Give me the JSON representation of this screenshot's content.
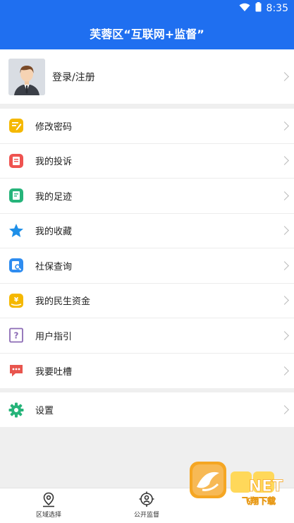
{
  "status_bar": {
    "time": "8:35"
  },
  "header": {
    "title": "芙蓉区“互联网+监督”"
  },
  "profile": {
    "label": "登录/注册"
  },
  "menu": [
    {
      "label": "修改密码",
      "icon": "edit-icon",
      "color": "#f5b800"
    },
    {
      "label": "我的投诉",
      "icon": "complaint-icon",
      "color": "#ef5350"
    },
    {
      "label": "我的足迹",
      "icon": "footprint-icon",
      "color": "#26b47a"
    },
    {
      "label": "我的收藏",
      "icon": "star-icon",
      "color": "#1e8fe8"
    },
    {
      "label": "社保查询",
      "icon": "search-doc-icon",
      "color": "#2e8cf0"
    },
    {
      "label": "我的民生资金",
      "icon": "yuan-icon",
      "color": "#f5b800"
    },
    {
      "label": "用户指引",
      "icon": "question-icon",
      "color": "#8c6bb5"
    },
    {
      "label": "我要吐槽",
      "icon": "chat-icon",
      "color": "#e8554e"
    }
  ],
  "settings": {
    "label": "设置",
    "icon": "gear-icon",
    "color": "#26b47a"
  },
  "tabs": [
    {
      "label": "区域选择",
      "icon": "location-icon"
    },
    {
      "label": "公开监督",
      "icon": "supervise-icon"
    }
  ],
  "watermark": {
    "text": "NET",
    "subtext": "飞翔下载"
  }
}
